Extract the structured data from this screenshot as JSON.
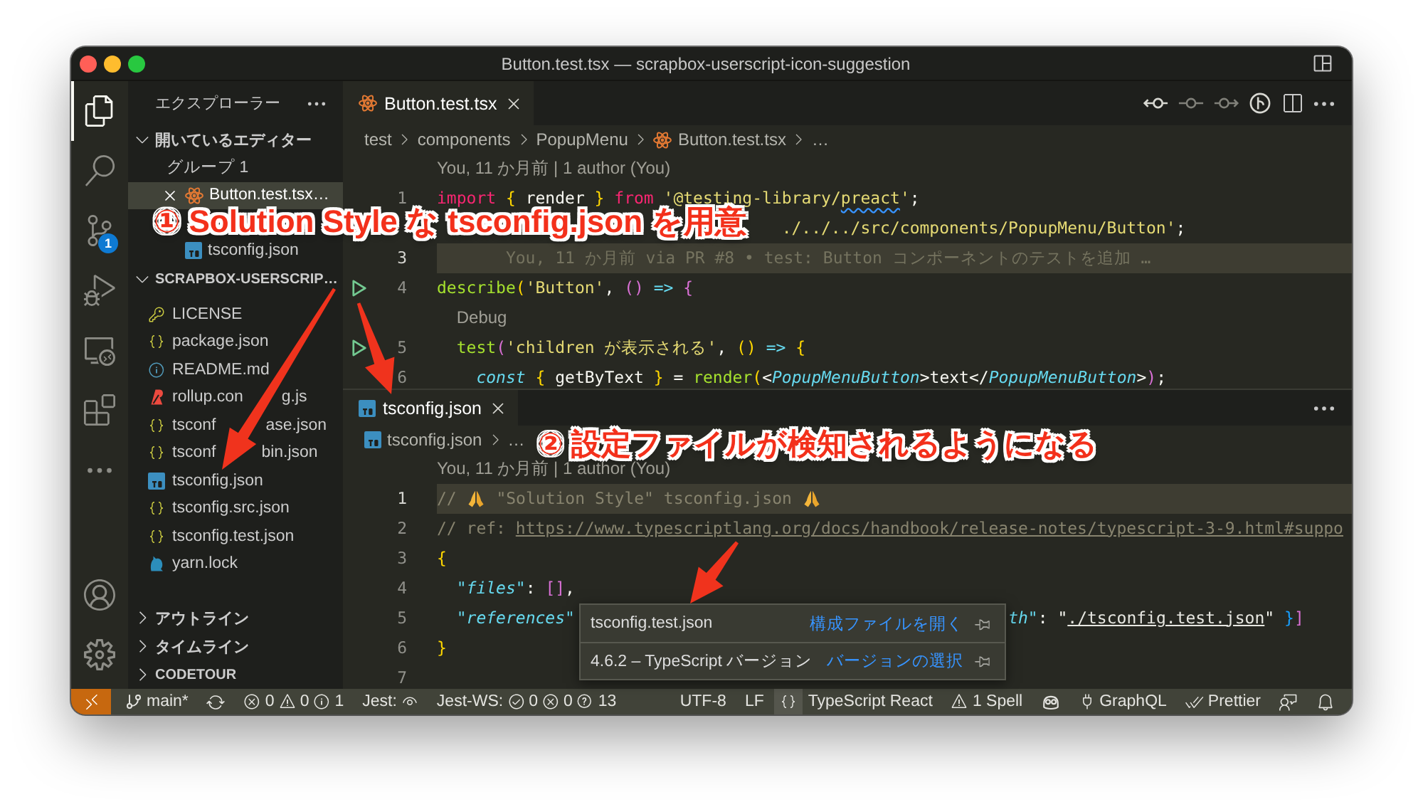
{
  "window": {
    "title": "Button.test.tsx — scrapbox-userscript-icon-suggestion"
  },
  "activity_bar": {
    "items": [
      {
        "selected": true
      },
      {
        "selected": false
      },
      {
        "selected": false,
        "badge": "1"
      },
      {
        "selected": false
      },
      {
        "selected": false
      },
      {
        "selected": false
      },
      {
        "selected": false
      }
    ],
    "bottom_items": [
      {
        "selected": false
      },
      {
        "selected": false
      }
    ]
  },
  "sidebar": {
    "title": "エクスプローラー",
    "open_editors": {
      "title": "開いているエディター",
      "expanded": true,
      "groups": [
        {
          "label": "グループ 1",
          "files": [
            {
              "name": "Button.test.tsx…",
              "kind": "react",
              "selected": true
            }
          ]
        },
        {
          "files": [
            {
              "name": "tsconfig.json",
              "kind": "typescript",
              "selected": false
            }
          ]
        }
      ]
    },
    "project": {
      "title": "SCRAPBOX-USERSCRIP…",
      "expanded": true,
      "files": [
        {
          "name": "LICENSE",
          "kind": "license",
          "selected": false
        },
        {
          "name": "package.json",
          "kind": "json",
          "selected": false
        },
        {
          "name": "README.md",
          "kind": "info",
          "selected": false
        },
        {
          "parts": [
            "rollup.con",
            "g.js"
          ],
          "kind": "rollup",
          "selected": false
        },
        {
          "parts": [
            "tsconf",
            "ase.json"
          ],
          "kind": "json",
          "selected": false
        },
        {
          "parts": [
            "tsconf",
            "bin.json"
          ],
          "kind": "json",
          "selected": false
        },
        {
          "name": "tsconfig.json",
          "kind": "typescript",
          "selected": false
        },
        {
          "name": "tsconfig.src.json",
          "kind": "json",
          "selected": false
        },
        {
          "name": "tsconfig.test.json",
          "kind": "json",
          "selected": false
        },
        {
          "name": "yarn.lock",
          "kind": "yarn",
          "selected": false
        }
      ]
    },
    "sections": [
      {
        "title": "アウトライン",
        "expanded": false
      },
      {
        "title": "タイムライン",
        "expanded": false
      },
      {
        "title": "CODETOUR",
        "expanded": false
      }
    ]
  },
  "editor_groups": [
    {
      "tabs": [
        {
          "label": "Button.test.tsx",
          "kind": "react",
          "selected": true
        }
      ],
      "breadcrumb": [
        {
          "label": "test"
        },
        {
          "label": "components"
        },
        {
          "label": "PopupMenu"
        },
        {
          "label": "Button.test.tsx",
          "kind": "react"
        },
        {
          "label": "…"
        }
      ],
      "rows": [
        {
          "kind": "lens",
          "text": "You, 11 か月前 | 1 author (You)"
        },
        {
          "kind": "code",
          "number": "1",
          "current": false,
          "run": false,
          "tokens": [
            {
              "text": "import ",
              "kind": "keyword"
            },
            {
              "text": "{",
              "kind": "bracket1"
            },
            {
              "text": " render ",
              "kind": "plain"
            },
            {
              "text": "}",
              "kind": "bracket1"
            },
            {
              "text": " from ",
              "kind": "keyword"
            },
            {
              "text": "'@testing-library/",
              "kind": "string"
            },
            {
              "text": "preact",
              "kind": "misspelled"
            },
            {
              "text": "'",
              "kind": "string"
            },
            {
              "text": ";",
              "kind": "plain"
            }
          ]
        },
        {
          "kind": "code",
          "current": false,
          "run": false,
          "tail": [
            {
              "text": "./../../src/components/PopupMenu/Button'",
              "kind": "string"
            },
            {
              "text": ";",
              "kind": "plain"
            }
          ]
        },
        {
          "kind": "code",
          "number": "3",
          "current": true,
          "run": false,
          "blame": "You, 11 か月前 via PR #8 • test: Button コンポーネントのテストを追加 …"
        },
        {
          "kind": "code",
          "number": "4",
          "current": false,
          "run": true,
          "tokens": [
            {
              "text": "describe",
              "kind": "function"
            },
            {
              "text": "(",
              "kind": "bracket1"
            },
            {
              "text": "'Button'",
              "kind": "string"
            },
            {
              "text": ", ",
              "kind": "plain"
            },
            {
              "text": "() ",
              "kind": "bracket2"
            },
            {
              "text": "=> ",
              "kind": "operator"
            },
            {
              "text": "{",
              "kind": "bracket2"
            }
          ]
        },
        {
          "kind": "lens",
          "text": "Debug"
        },
        {
          "kind": "code",
          "number": "5",
          "current": false,
          "run": true,
          "tokens": [
            {
              "text": "  test",
              "kind": "function"
            },
            {
              "text": "(",
              "kind": "bracket2"
            },
            {
              "text": "'children が表示される'",
              "kind": "string"
            },
            {
              "text": ", ",
              "kind": "plain"
            },
            {
              "text": "() ",
              "kind": "bracket1"
            },
            {
              "text": "=> ",
              "kind": "operator"
            },
            {
              "text": "{",
              "kind": "bracket1"
            }
          ]
        },
        {
          "kind": "code",
          "number": "6",
          "current": false,
          "run": false,
          "tokens": [
            {
              "text": "    const ",
              "kind": "storage"
            },
            {
              "text": "{",
              "kind": "bracket1"
            },
            {
              "text": " getByText ",
              "kind": "plain"
            },
            {
              "text": "}",
              "kind": "bracket1"
            },
            {
              "text": " = ",
              "kind": "plain"
            },
            {
              "text": "render",
              "kind": "function"
            },
            {
              "text": "(",
              "kind": "bracket1"
            },
            {
              "text": "<",
              "kind": "plain"
            },
            {
              "text": "PopupMenuButton",
              "kind": "tag"
            },
            {
              "text": ">text</",
              "kind": "plain"
            },
            {
              "text": "PopupMenuButton",
              "kind": "tag"
            },
            {
              "text": ">",
              "kind": "plain"
            },
            {
              "text": ")",
              "kind": "bracket2"
            },
            {
              "text": ";",
              "kind": "plain"
            }
          ]
        }
      ]
    },
    {
      "tabs": [
        {
          "label": "tsconfig.json",
          "kind": "typescript",
          "selected": true
        }
      ],
      "breadcrumb": [
        {
          "label": "tsconfig.json",
          "kind": "typescript"
        },
        {
          "label": "…"
        }
      ],
      "rows": [
        {
          "kind": "lens",
          "text": "You, 11 か月前 | 1 author (You)"
        },
        {
          "kind": "code",
          "number": "1",
          "current": true,
          "run": false,
          "tokens": [
            {
              "text": "// ",
              "kind": "comment"
            },
            {
              "kind": "emoji"
            },
            {
              "text": " \"Solution Style\" tsconfig.json ",
              "kind": "comment"
            },
            {
              "kind": "emoji"
            }
          ]
        },
        {
          "kind": "code",
          "number": "2",
          "current": false,
          "run": false,
          "tokens": [
            {
              "text": "// ref: ",
              "kind": "comment"
            },
            {
              "text": "https://www.typescriptlang.org/docs/handbook/release-notes/typescript-3-9.html#suppo",
              "kind": "comment_link"
            }
          ]
        },
        {
          "kind": "code",
          "number": "3",
          "current": false,
          "run": false,
          "tokens": [
            {
              "text": "{",
              "kind": "bracket1"
            }
          ]
        },
        {
          "kind": "code",
          "number": "4",
          "current": false,
          "run": false,
          "tokens": [
            {
              "text": "  \"files\"",
              "kind": "key"
            },
            {
              "text": ": ",
              "kind": "plain"
            },
            {
              "text": "[]",
              "kind": "bracket2"
            },
            {
              "text": ",",
              "kind": "plain"
            }
          ]
        },
        {
          "kind": "code",
          "number": "5",
          "current": false,
          "run": false,
          "tokens": [
            {
              "text": "  \"references\"",
              "kind": "key"
            }
          ],
          "tail": [
            {
              "text": "th\"",
              "kind": "key"
            },
            {
              "text": ": ",
              "kind": "plain"
            },
            {
              "text": "\"",
              "kind": "plain"
            },
            {
              "text": "./tsconfig.test.json",
              "kind": "link"
            },
            {
              "text": "\" ",
              "kind": "plain"
            },
            {
              "text": "}",
              "kind": "bracket3"
            },
            {
              "text": "]",
              "kind": "bracket2"
            }
          ]
        },
        {
          "kind": "code",
          "number": "6",
          "current": false,
          "run": false,
          "tokens": [
            {
              "text": "}",
              "kind": "bracket1"
            }
          ]
        },
        {
          "kind": "code",
          "number": "7",
          "current": false,
          "run": false
        }
      ]
    }
  ],
  "status_bar": {
    "branch": "main*",
    "problems": {
      "errors": "0",
      "warnings": "0",
      "infos": "1"
    },
    "jest": "Jest:",
    "jest_ws": {
      "label": "Jest-WS:",
      "passed": "0",
      "failed": "0",
      "unknown": "13"
    },
    "encoding": "UTF-8",
    "eol": "LF",
    "language_status": {
      "open": true,
      "rows": [
        {
          "label": "tsconfig.test.json",
          "action": "構成ファイルを開く"
        },
        {
          "label": "4.6.2 – TypeScript バージョン",
          "action": "バージョンの選択"
        }
      ]
    },
    "language": "TypeScript React",
    "spell": "1 Spell",
    "graphql": "GraphQL",
    "prettier": "Prettier"
  },
  "annotations": [
    {
      "text": "① Solution Style な tsconfig.json を用意"
    },
    {
      "text": "② 設定ファイルが検知されるようになる"
    }
  ]
}
